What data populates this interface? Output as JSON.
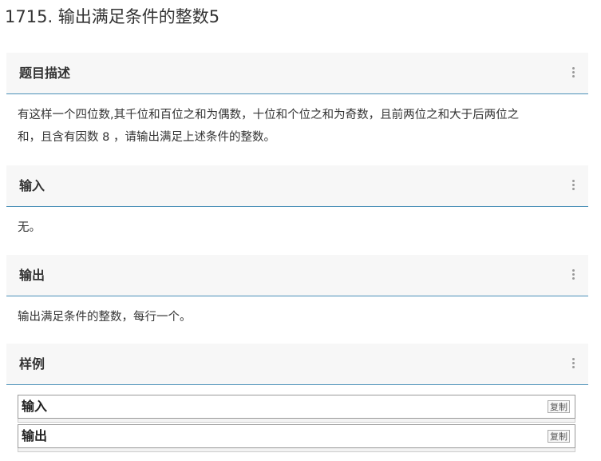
{
  "problem": {
    "title": "1715. 输出满足条件的整数5"
  },
  "sections": {
    "description": {
      "heading": "题目描述",
      "text_line1": "有这样一个四位数,其千位和百位之和为偶数，十位和个位之和为奇数，且前两位之和大于后两位之",
      "text_line2": "和，且含有因数 8 ，请输出满足上述条件的整数。"
    },
    "input": {
      "heading": "输入",
      "text": "无。"
    },
    "output": {
      "heading": "输出",
      "text": "输出满足条件的整数，每行一个。"
    },
    "sample": {
      "heading": "样例",
      "input_label": "输入",
      "output_label": "输出",
      "copy_label": "复制"
    }
  },
  "icons": {
    "section_menu": "more-vertical-icon"
  },
  "colors": {
    "header_bg": "#f7f7f7",
    "header_border": "#4a90b8",
    "text": "#333333"
  }
}
